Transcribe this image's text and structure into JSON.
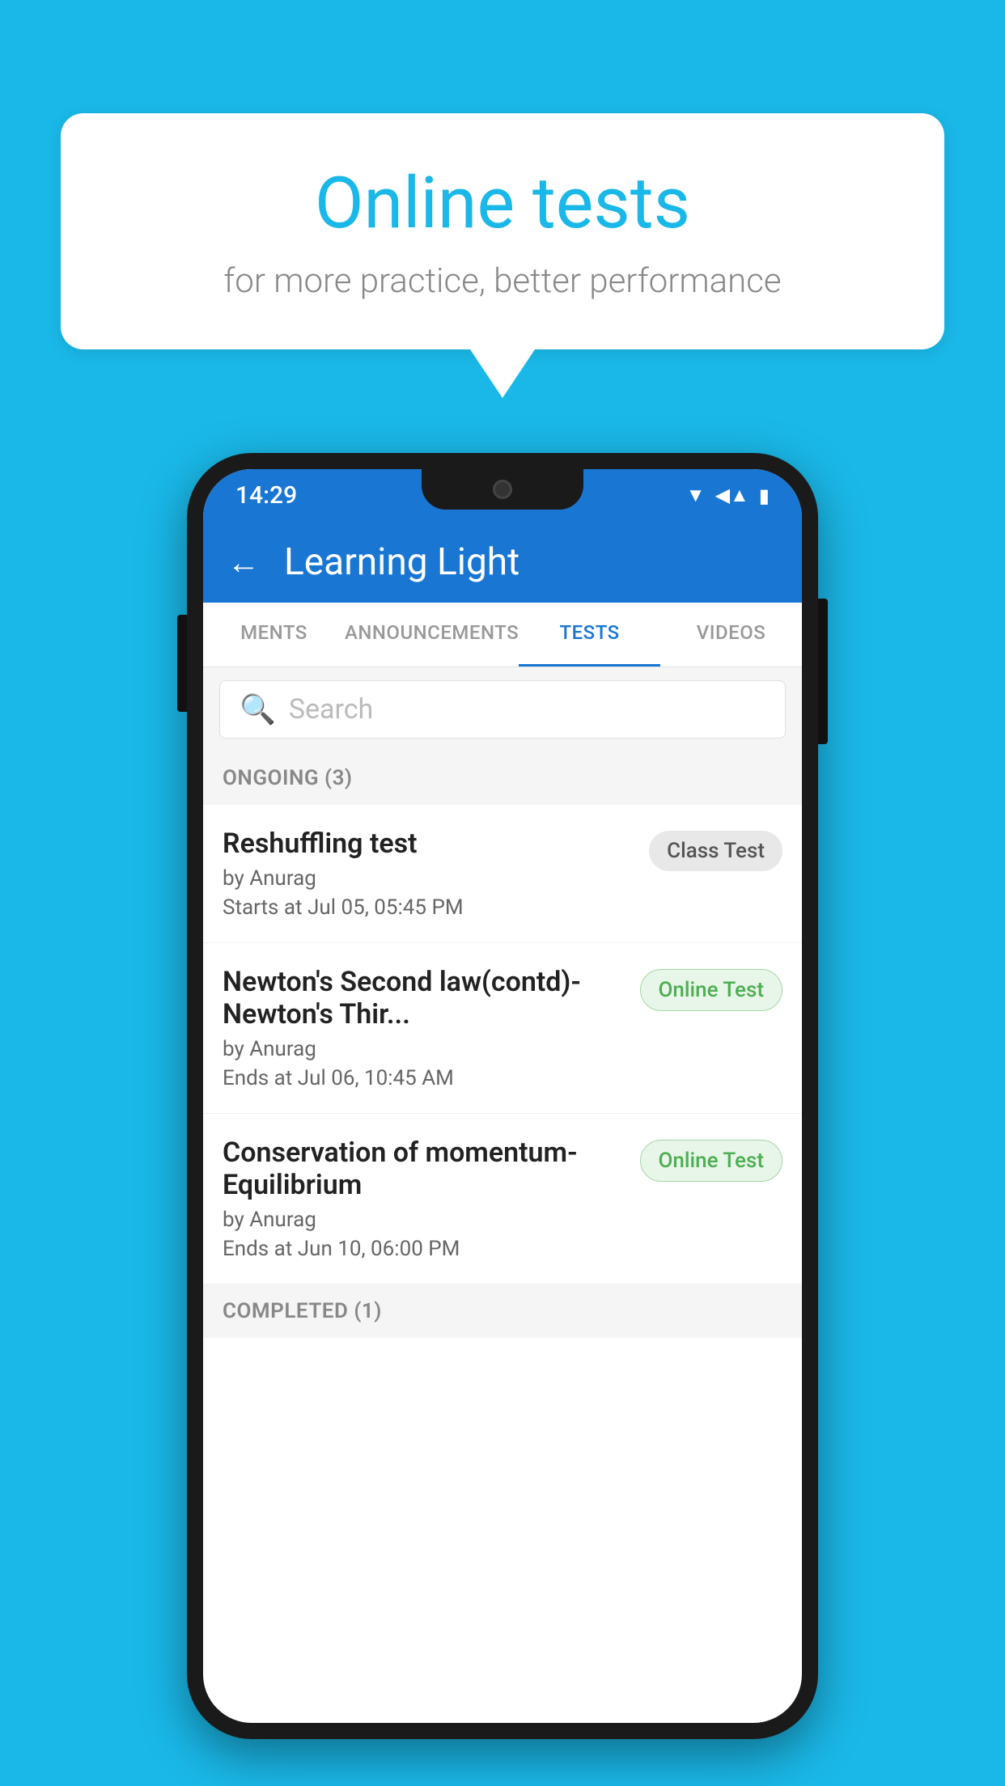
{
  "background": {
    "color": "#1ab8e8"
  },
  "speech_bubble": {
    "title": "Online tests",
    "subtitle": "for more practice, better performance"
  },
  "phone": {
    "status_bar": {
      "time": "14:29",
      "wifi": "▼",
      "signal": "◀",
      "battery": "▮"
    },
    "app_bar": {
      "back_label": "←",
      "title": "Learning Light"
    },
    "tabs": [
      {
        "label": "MENTS",
        "active": false
      },
      {
        "label": "ANNOUNCEMENTS",
        "active": false
      },
      {
        "label": "TESTS",
        "active": true
      },
      {
        "label": "VIDEOS",
        "active": false
      }
    ],
    "search": {
      "placeholder": "Search"
    },
    "ongoing_section": {
      "title": "ONGOING (3)"
    },
    "tests": [
      {
        "name": "Reshuffling test",
        "author": "by Anurag",
        "time_label": "Starts at",
        "time": "Jul 05, 05:45 PM",
        "badge": "Class Test",
        "badge_type": "class"
      },
      {
        "name": "Newton's Second law(contd)-Newton's Thir...",
        "author": "by Anurag",
        "time_label": "Ends at",
        "time": "Jul 06, 10:45 AM",
        "badge": "Online Test",
        "badge_type": "online"
      },
      {
        "name": "Conservation of momentum-Equilibrium",
        "author": "by Anurag",
        "time_label": "Ends at",
        "time": "Jun 10, 06:00 PM",
        "badge": "Online Test",
        "badge_type": "online"
      }
    ],
    "completed_section": {
      "title": "COMPLETED (1)"
    }
  }
}
